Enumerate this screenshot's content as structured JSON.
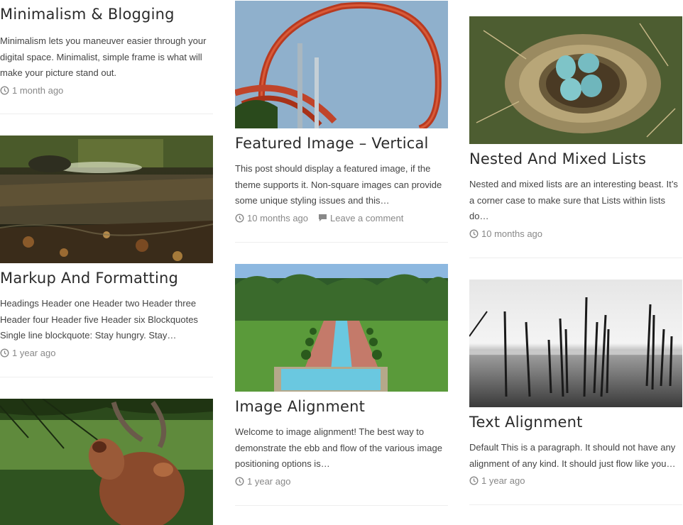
{
  "posts": [
    {
      "title": "Minimalism & Blogging",
      "excerpt": "Minimalism lets you maneuver easier through your digital space. Minimalist, simple frame is what will make your picture stand out.",
      "date": "1 month ago"
    },
    {
      "title": "Markup And Formatting",
      "excerpt": "Headings Header one Header two Header three Header four Header five Header six Blockquotes Single line blockquote: Stay hungry. Stay…",
      "date": "1 year ago"
    },
    {
      "title": "Featured Image – Vertical",
      "excerpt": "This post should display a featured image, if the theme supports it. Non-square images can provide some unique styling issues and this…",
      "date": "10 months ago",
      "comments": "Leave a comment"
    },
    {
      "title": "Image Alignment",
      "excerpt": "Welcome to image alignment! The best way to demonstrate the ebb and flow of the various image positioning options is…",
      "date": "1 year ago"
    },
    {
      "title": "Nested And Mixed Lists",
      "excerpt": "Nested and mixed lists are an interesting beast. It’s a corner case to make sure that Lists within lists do…",
      "date": "10 months ago"
    },
    {
      "title": "Text Alignment",
      "excerpt": "Default This is a paragraph. It should not have any alignment of any kind. It should just flow like you…",
      "date": "1 year ago"
    }
  ],
  "icons": {
    "clock": "clock-icon",
    "comment": "comment-icon"
  }
}
